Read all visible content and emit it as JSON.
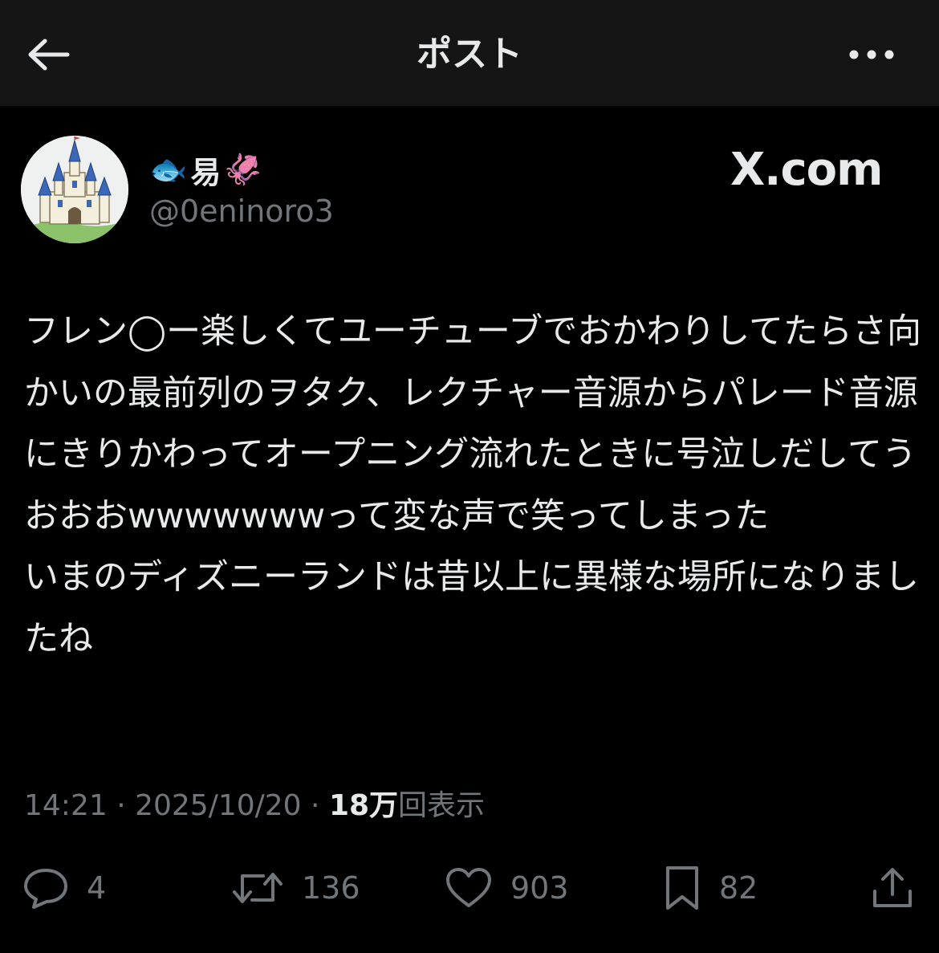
{
  "header": {
    "title": "ポスト",
    "back_icon": "arrow-left-icon",
    "more_icon": "more-horizontal-icon"
  },
  "post": {
    "author": {
      "emoji_left": "🐟",
      "name": "易",
      "emoji_right": "🦑",
      "handle": "@0eninoro3",
      "avatar_icon": "castle-icon"
    },
    "watermark": "X.com",
    "text": "フレン◯ー楽しくてユーチューブでおかわりしてたらさ向かいの最前列のヲタク、レクチャー音源からパレード音源にきりかわってオープニング流れたときに号泣しだしてうおおおwwwwwwwって変な声で笑ってしまった\nいまのディズニーランドは昔以上に異様な場所になりましたね",
    "time": "14:21",
    "separator": " · ",
    "date": "2025/10/20",
    "views_count": "18万",
    "views_label": "回表示"
  },
  "actions": {
    "reply_count": "4",
    "repost_count": "136",
    "like_count": "903",
    "bookmark_count": "82"
  },
  "colors": {
    "background": "#000000",
    "header_background": "#151515",
    "text_primary": "#e7e9ea",
    "text_secondary": "#71767b"
  }
}
